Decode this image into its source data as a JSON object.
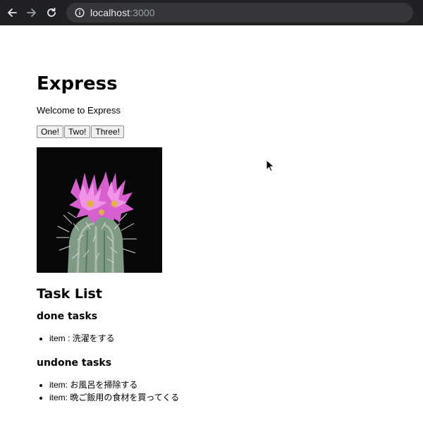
{
  "browser": {
    "url_host": "localhost",
    "url_port": ":3000",
    "icons": [
      "back-arrow-icon",
      "forward-arrow-icon",
      "reload-icon",
      "info-icon"
    ]
  },
  "page": {
    "title": "Express",
    "welcome": "Welcome to Express",
    "buttons": [
      "One!",
      "Two!",
      "Three!"
    ],
    "image_subject": "pink flowering cactus",
    "task_list_heading": "Task List",
    "done_heading": "done tasks",
    "done_items": [
      "item : 洗濯をする"
    ],
    "undone_heading": "undone tasks",
    "undone_items": [
      "item: お風呂を掃除する",
      "item: 晩ご飯用の食材を買ってくる"
    ]
  },
  "colors": {
    "browser_bar": "#202124",
    "address_bar": "#35363a",
    "flower_pink": "#d85fd0",
    "cactus_green": "#7f9a84"
  }
}
